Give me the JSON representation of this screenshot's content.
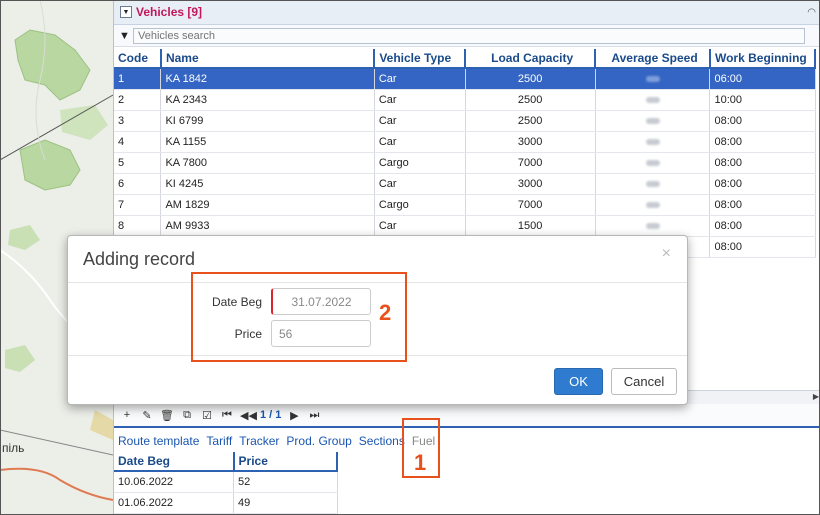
{
  "panel": {
    "title": "Vehicles [9]",
    "search_placeholder": "Vehicles search"
  },
  "vehicles": {
    "columns": [
      "Code",
      "Name",
      "Vehicle Type",
      "Load Capacity",
      "Average Speed",
      "Work Beginning"
    ],
    "rows": [
      {
        "code": "1",
        "name": "KA 1842",
        "type": "Car",
        "capacity": "2500",
        "work_begin": "06:00"
      },
      {
        "code": "2",
        "name": "KA 2343",
        "type": "Car",
        "capacity": "2500",
        "work_begin": "10:00"
      },
      {
        "code": "3",
        "name": "KI 6799",
        "type": "Car",
        "capacity": "2500",
        "work_begin": "08:00"
      },
      {
        "code": "4",
        "name": "KA 1155",
        "type": "Car",
        "capacity": "3000",
        "work_begin": "08:00"
      },
      {
        "code": "5",
        "name": "KA 7800",
        "type": "Cargo",
        "capacity": "7000",
        "work_begin": "08:00"
      },
      {
        "code": "6",
        "name": "KI 4245",
        "type": "Car",
        "capacity": "3000",
        "work_begin": "08:00"
      },
      {
        "code": "7",
        "name": "AM 1829",
        "type": "Cargo",
        "capacity": "7000",
        "work_begin": "08:00"
      },
      {
        "code": "8",
        "name": "AM 9933",
        "type": "Car",
        "capacity": "1500",
        "work_begin": "08:00"
      },
      {
        "code": "",
        "name": "",
        "type": "",
        "capacity": "",
        "work_begin": "08:00"
      }
    ]
  },
  "toolbar": {
    "pager": "1 / 1"
  },
  "tabs": [
    "Route template",
    "Tariff",
    "Tracker",
    "Prod. Group",
    "Sections",
    "Fuel"
  ],
  "fuel": {
    "columns": [
      "Date Beg",
      "Price"
    ],
    "rows": [
      {
        "date": "10.06.2022",
        "price": "52"
      },
      {
        "date": "01.06.2022",
        "price": "49"
      }
    ]
  },
  "modal": {
    "title": "Adding record",
    "close": "×",
    "date_label": "Date Beg",
    "date_value": "31.07.2022",
    "price_label": "Price",
    "price_value": "56",
    "ok": "OK",
    "cancel": "Cancel"
  },
  "annotations": {
    "one": "1",
    "two": "2"
  },
  "map": {
    "town_label": "піль"
  },
  "colors": {
    "accent": "#2d62b3",
    "selected_row": "#3465c4",
    "title": "#c2185b",
    "annotation": "#e8501c",
    "ok_button": "#2f7bcf"
  }
}
